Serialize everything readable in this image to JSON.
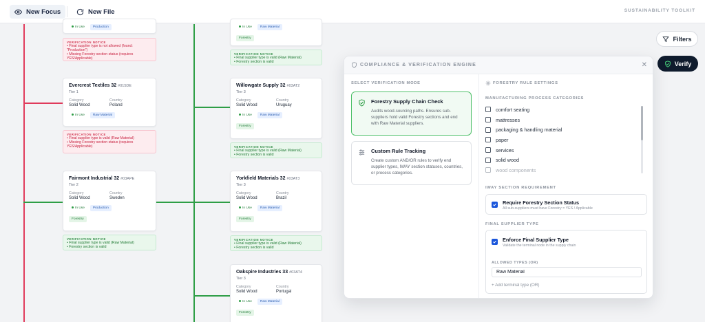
{
  "topbar": {
    "new_focus": "New Focus",
    "new_file": "New File",
    "toolkit": "SUSTAINABILITY TOOLKIT"
  },
  "labels": {
    "category": "Category",
    "country": "Country"
  },
  "cards": [
    {
      "name": "Evercrest Textiles 32",
      "code": "#015DE",
      "tier": "Tier 1",
      "category": "Solid Wood",
      "country": "Poland",
      "status": "In Use",
      "tags": [
        "Raw Material"
      ]
    },
    {
      "name": "Fairmont Industrial 32",
      "code": "#03APE",
      "tier": "Tier 2",
      "category": "Solid Wood",
      "country": "Sweden",
      "status": "In Use",
      "tags": [
        "Production"
      ],
      "extra_tag": "Forestry"
    },
    {
      "name": "Willowgate Supply 32",
      "code": "#03AT2",
      "tier": "Tier 3",
      "category": "Solid Wood",
      "country": "Uruguay",
      "status": "In Use",
      "tags": [
        "Raw Material"
      ],
      "extra_tag": "Forestry"
    },
    {
      "name": "Yorkfield Materials 32",
      "code": "#03AT3",
      "tier": "Tier 3",
      "category": "Solid Wood",
      "country": "Brazil",
      "status": "In Use",
      "tags": [
        "Raw Material"
      ],
      "extra_tag": "Forestry"
    },
    {
      "name": "Oakspire Industries 33",
      "code": "#03AT4",
      "tier": "Tier 3",
      "category": "Solid Wood",
      "country": "Portugal",
      "status": "In Use",
      "tags": [
        "Raw Material"
      ],
      "extra_tag": "Forestry"
    }
  ],
  "partial_cards": {
    "top_left": {
      "status": "In Use",
      "tag": "Production"
    },
    "top_mid": {
      "status": "In Use",
      "tag": "Raw Material",
      "extra_tag": "Forestry"
    }
  },
  "notices": {
    "n1": {
      "title": "VERIFICATION NOTICE",
      "lines": [
        "• Final supplier type is not allowed (found: \"Production\")",
        "• Missing Forestry section status (requires YES/Applicable)"
      ]
    },
    "n2": {
      "title": "VERIFICATION NOTICE",
      "lines": [
        "• Final supplier type is valid (Raw Material)",
        "• Missing Forestry section status (requires YES/Applicable)"
      ]
    },
    "n3": {
      "title": "VERIFICATION NOTICE",
      "lines": [
        "• Final supplier type is valid (Raw Material)",
        "• Forestry section is valid"
      ]
    },
    "n4": {
      "title": "VERIFICATION NOTICE",
      "lines": [
        "• Final supplier type is valid (Raw Material)",
        "• Forestry section is valid"
      ]
    },
    "n5": {
      "title": "VERIFICATION NOTICE",
      "lines": [
        "• Final supplier type is valid (Raw Material)",
        "• Forestry section is valid"
      ]
    },
    "n6": {
      "title": "VERIFICATION NOTICE",
      "lines": [
        "• Final supplier type is valid (Raw Material)",
        "• Forestry section is valid"
      ]
    }
  },
  "buttons": {
    "filters": "Filters",
    "verify": "Verify"
  },
  "panel": {
    "title": "COMPLIANCE & VERIFICATION ENGINE",
    "left": {
      "section_label": "SELECT VERIFICATION MODE",
      "modes": [
        {
          "title": "Forestry Supply Chain Check",
          "desc": "Audits wood-sourcing paths. Ensures sub-suppliers hold valid Forestry sections and end with Raw Material suppliers."
        },
        {
          "title": "Custom Rule Tracking",
          "desc": "Create custom AND/OR rules to verify end supplier types, IWAY section statuses, countries, or process categories."
        }
      ]
    },
    "right": {
      "title": "FORESTRY RULE SETTINGS",
      "categories_label": "MANUFACTURING PROCESS CATEGORIES",
      "categories": [
        "comfort seating",
        "mattresses",
        "packaging & handling material",
        "paper",
        "services",
        "solid wood",
        "wood components"
      ],
      "iway_label": "IWAY SECTION REQUIREMENT",
      "iway_title": "Require Forestry Section Status",
      "iway_desc": "All sub-suppliers must have Forestry = YES / Applicable",
      "final_label": "FINAL SUPPLIER TYPE",
      "final_title": "Enforce Final Supplier Type",
      "final_desc": "Validate the terminal node in the supply chain",
      "allowed_label": "ALLOWED TYPES (OR)",
      "allowed_value": "Raw Material",
      "add_type": "+ Add terminal type (OR)"
    }
  },
  "colors": {
    "error": "#e03a5b",
    "ok": "#2e9e46",
    "accent": "#1a56db",
    "dark": "#0f1b2d"
  }
}
